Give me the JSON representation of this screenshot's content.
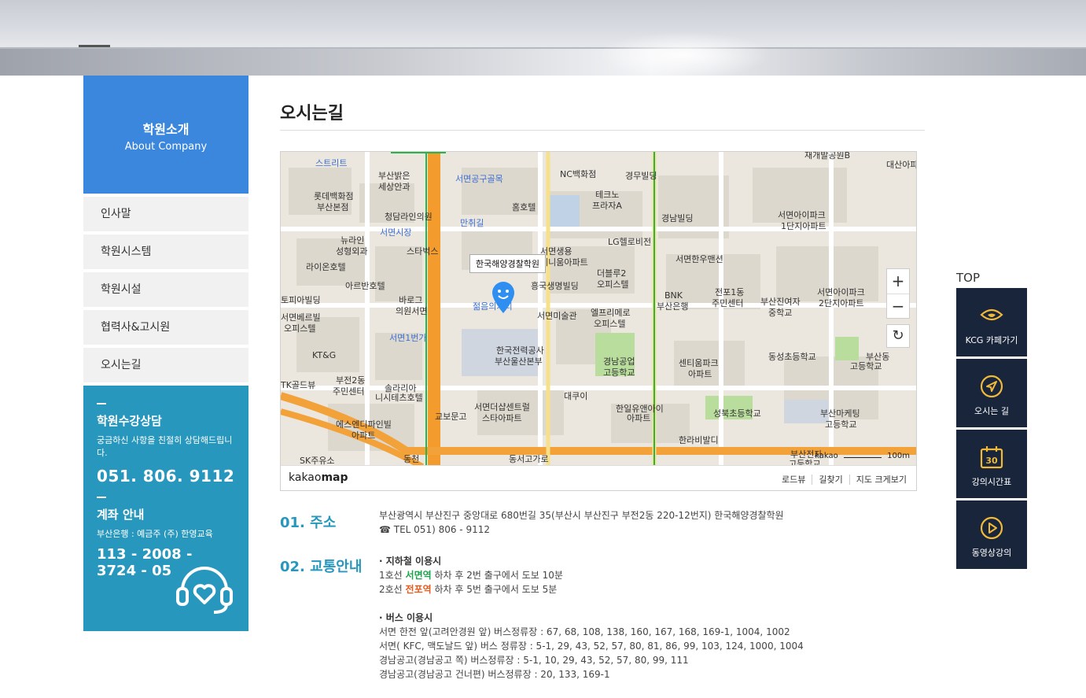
{
  "sidebar": {
    "title_ko": "학원소개",
    "title_en": "About Company",
    "items": [
      {
        "label": "인사말"
      },
      {
        "label": "학원시스템"
      },
      {
        "label": "학원시설"
      },
      {
        "label": "협력사&고시원"
      },
      {
        "label": "오시는길"
      }
    ],
    "consult": {
      "title": "학원수강상담",
      "subtitle": "궁금하신 사항을 친절히 상담해드립니다.",
      "phone": "051. 806. 9112",
      "account_title": "계좌 안내",
      "account_bank": "부산은행 : 예금주 (주) 한영교육",
      "account_number": "113 - 2008 - 3724 - 05"
    }
  },
  "page": {
    "title": "오시는길"
  },
  "map": {
    "pin_label": "한국해양경찰학원",
    "logo_a": "kakao",
    "logo_b": "map",
    "links": [
      "로드뷰",
      "길찾기",
      "지도 크게보기"
    ],
    "scale": "100m",
    "scale_brand": "kakao",
    "labels": [
      {
        "text": "스트리트",
        "blue": true
      },
      {
        "text": "부산밝은",
        "blue": false
      },
      {
        "text": "세상안과",
        "blue": false
      },
      {
        "text": "서면공구골목",
        "blue": true
      },
      {
        "text": "NC백화점",
        "blue": false
      },
      {
        "text": "경무빌딩",
        "blue": false
      },
      {
        "text": "재개발공원B",
        "blue": false
      },
      {
        "text": "대산아파",
        "blue": false
      },
      {
        "text": "롯데백화점",
        "blue": false
      },
      {
        "text": "부산본점",
        "blue": false
      },
      {
        "text": "테크노",
        "blue": false
      },
      {
        "text": "프라자A",
        "blue": false
      },
      {
        "text": "청담라인의원",
        "blue": false
      },
      {
        "text": "홈호텔",
        "blue": false
      },
      {
        "text": "경남빌딩",
        "blue": false
      },
      {
        "text": "서면아이파크",
        "blue": false
      },
      {
        "text": "1단지아파트",
        "blue": false
      },
      {
        "text": "서면시장",
        "blue": true
      },
      {
        "text": "만취길",
        "blue": true
      },
      {
        "text": "뉴라인",
        "blue": false
      },
      {
        "text": "성형외과",
        "blue": false
      },
      {
        "text": "스타벅스",
        "blue": false
      },
      {
        "text": "LG헬로비전",
        "blue": false
      },
      {
        "text": "라이온호텔",
        "blue": false
      },
      {
        "text": "서면생용",
        "blue": false
      },
      {
        "text": "테니움아파트",
        "blue": false
      },
      {
        "text": "서면한우맨션",
        "blue": false
      },
      {
        "text": "아르반호텔",
        "blue": false
      },
      {
        "text": "흥국생명빌딩",
        "blue": false
      },
      {
        "text": "더블루2",
        "blue": false
      },
      {
        "text": "오피스텔",
        "blue": false
      },
      {
        "text": "전포1동",
        "blue": false
      },
      {
        "text": "주민센터",
        "blue": false
      },
      {
        "text": "토피아빌딩",
        "blue": false
      },
      {
        "text": "바로그",
        "blue": false
      },
      {
        "text": "의원서면",
        "blue": false
      },
      {
        "text": "젊음의거리",
        "blue": true
      },
      {
        "text": "BNK",
        "blue": false
      },
      {
        "text": "부산은행",
        "blue": false
      },
      {
        "text": "부산진여자",
        "blue": false
      },
      {
        "text": "중학교",
        "blue": false
      },
      {
        "text": "서면아이파크",
        "blue": false
      },
      {
        "text": "2단지아파트",
        "blue": false
      },
      {
        "text": "서면베르빌",
        "blue": false
      },
      {
        "text": "오피스텔",
        "blue": false
      },
      {
        "text": "서면미술관",
        "blue": false
      },
      {
        "text": "엘프리메로",
        "blue": false
      },
      {
        "text": "오피스텔",
        "blue": false
      },
      {
        "text": "서면1번가",
        "blue": true
      },
      {
        "text": "한국전력공사",
        "blue": false
      },
      {
        "text": "부산울산본부",
        "blue": false
      },
      {
        "text": "경남공업",
        "blue": false
      },
      {
        "text": "고등학교",
        "blue": false
      },
      {
        "text": "센티움파크",
        "blue": false
      },
      {
        "text": "아파트",
        "blue": false
      },
      {
        "text": "동성초등학교",
        "blue": false
      },
      {
        "text": "부산동",
        "blue": false
      },
      {
        "text": "고등학교",
        "blue": false
      },
      {
        "text": "KT&G",
        "blue": false
      },
      {
        "text": "부전2동",
        "blue": false
      },
      {
        "text": "주민센터",
        "blue": false
      },
      {
        "text": "TK골드뷰",
        "blue": false
      },
      {
        "text": "솔라리아",
        "blue": false
      },
      {
        "text": "니시테츠호텔",
        "blue": false
      },
      {
        "text": "대쿠이",
        "blue": false
      },
      {
        "text": "한일유앤아이",
        "blue": false
      },
      {
        "text": "아파트",
        "blue": false
      },
      {
        "text": "성북초등학교",
        "blue": false
      },
      {
        "text": "부산마케팅",
        "blue": false
      },
      {
        "text": "고등학교",
        "blue": false
      },
      {
        "text": "교보문고",
        "blue": false
      },
      {
        "text": "서면더샵센트럴",
        "blue": false
      },
      {
        "text": "스타아파트",
        "blue": false
      },
      {
        "text": "에스엔디파인빌",
        "blue": false
      },
      {
        "text": "아파트",
        "blue": false
      },
      {
        "text": "한라비발디",
        "blue": false
      },
      {
        "text": "SK주유소",
        "blue": false
      },
      {
        "text": "동천",
        "blue": false
      },
      {
        "text": "동서고가로",
        "blue": false
      },
      {
        "text": "부산전자",
        "blue": false
      },
      {
        "text": "고등학교",
        "blue": false
      }
    ]
  },
  "info": {
    "address_title": "01. 주소",
    "address": "부산광역시 부산진구 중앙대로 680번길 35(부산시 부산진구 부전2동 220-12번지) 한국해양경찰학원",
    "tel": "☎ TEL 051) 806 - 9112",
    "transport_title": "02. 교통안내",
    "subway_title": "· 지하철 이용시",
    "subway1_pre": "1호선 ",
    "subway1_station": "서면역",
    "subway1_post": " 하차 후 2번 출구에서 도보 10분",
    "subway2_pre": "2호선 ",
    "subway2_station": "전포역",
    "subway2_post": " 하차 후 5번 출구에서 도보 5분",
    "bus_title": "· 버스 이용시",
    "bus_lines": [
      "서면 한전 앞(고려안경원 앞) 버스정류장 : 67, 68, 108, 138, 160, 167, 168, 169-1, 1004, 1002",
      "서면( KFC, 맥도날드 앞) 버스 정류장 : 5-1, 29, 43, 52, 57, 80, 81, 86, 99, 103, 124, 1000, 1004",
      "경남공고(경남공고 쪽) 버스정류장 : 5-1, 10, 29, 43, 52, 57, 80, 99, 111",
      "경남공고(경남공고 건너편) 버스정류장 : 20, 133, 169-1"
    ]
  },
  "quick": {
    "top_label": "TOP",
    "buttons": [
      {
        "label": "KCG 카페가기",
        "icon": "cafe-icon"
      },
      {
        "label": "오시는 길",
        "icon": "navigation-icon"
      },
      {
        "label": "강의시간표",
        "icon": "calendar-icon",
        "calendar_number": "30"
      },
      {
        "label": "동영상강의",
        "icon": "play-icon"
      }
    ]
  },
  "colors": {
    "sidebar_head": "#3b87de",
    "consult_bg": "#2897bd",
    "quick_bg": "#19253a",
    "quick_icon": "#f0b93a",
    "accent_text": "#2897bd"
  }
}
